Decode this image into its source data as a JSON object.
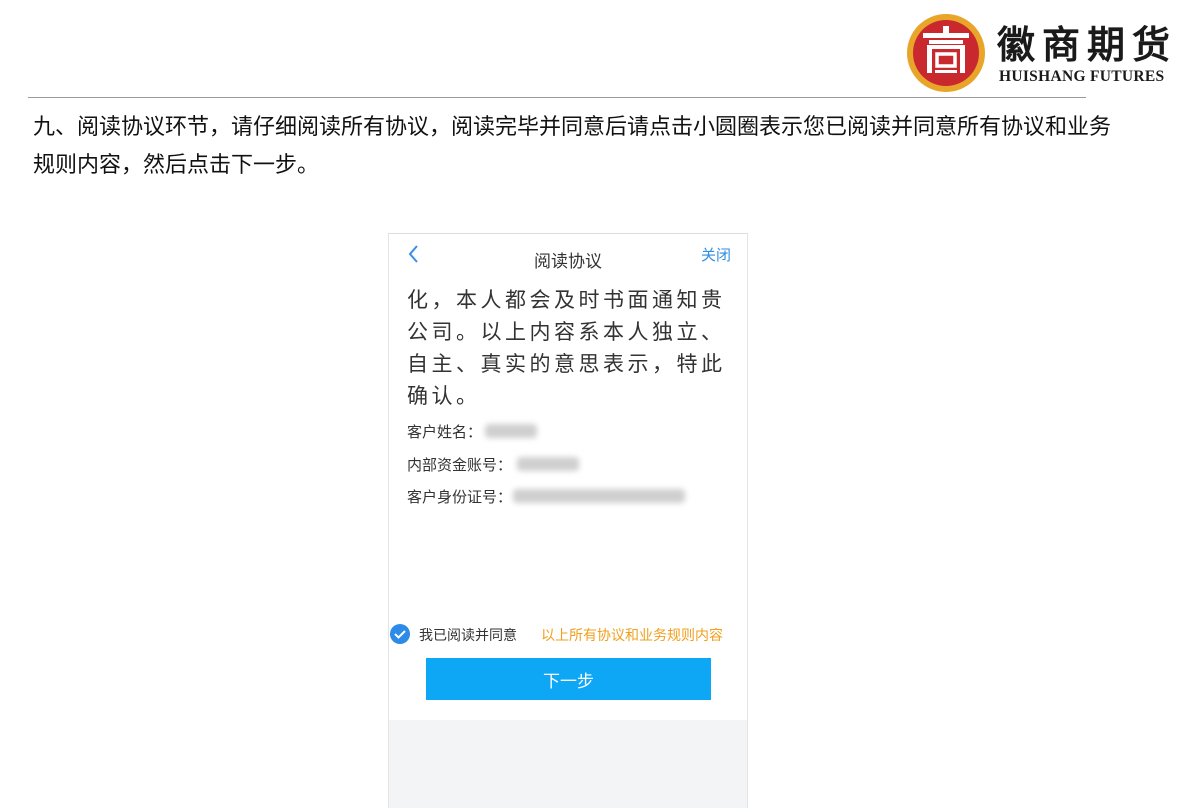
{
  "brand": {
    "name_cn": "徽商期货",
    "name_en": "HUISHANG FUTURES",
    "seal_color": "#c8282e",
    "seal_ring_color": "#e8a52a"
  },
  "instruction": "九、阅读协议环节，请仔细阅读所有协议，阅读完毕并同意后请点击小圆圈表示您已阅读并同意所有协议和业务规则内容，然后点击下一步。",
  "phone": {
    "back_icon": "chevron-left-icon",
    "back_glyph": "<",
    "title": "阅读协议",
    "close_label": "关闭",
    "agreement_text": "化，本人都会及时书面通知贵公司。以上内容系本人独立、自主、真实的意思表示，特此确认。",
    "fields": [
      {
        "label": "客户姓名："
      },
      {
        "label": "内部资金账号："
      },
      {
        "label": "客户身份证号："
      }
    ],
    "agree_checked": true,
    "agree_text": "我已阅读并同意",
    "agree_link": "以上所有协议和业务规则内容",
    "next_button": "下一步"
  },
  "colors": {
    "accent_blue": "#2d8ae6",
    "button_blue": "#0ea7f5",
    "link_orange": "#f0a01e"
  }
}
